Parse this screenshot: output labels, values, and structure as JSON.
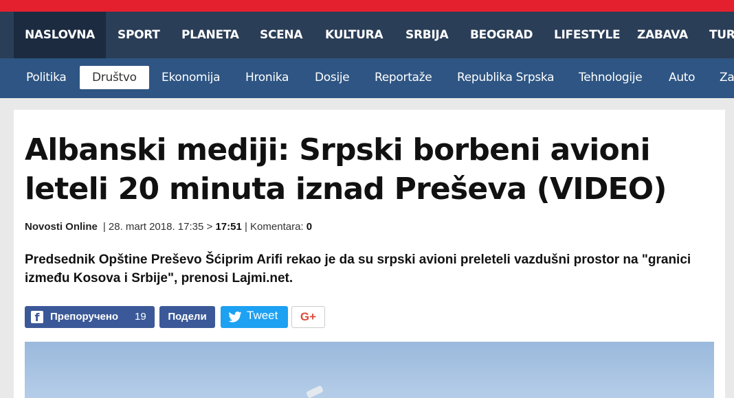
{
  "main_nav": [
    "NASLOVNA",
    "SPORT",
    "PLANETA",
    "SCENA",
    "KULTURA",
    "SRBIJA",
    "BEOGRAD",
    "LIFESTYLE",
    "ZABAVA",
    "TUR"
  ],
  "sub_nav": [
    "Politika",
    "Društvo",
    "Ekonomija",
    "Hronika",
    "Dosije",
    "Reportaže",
    "Republika Srpska",
    "Tehnologije",
    "Auto",
    "Za"
  ],
  "article": {
    "title": "Albanski mediji: Srpski borbeni avioni leteli 20 minuta iznad Preševa (VIDEO)",
    "source": "Novosti Online",
    "date_prefix": "| 28. mart 2018. 17:35 > ",
    "time": "17:51",
    "comments_label": " | Komentara: ",
    "comments": "0",
    "lead": "Predsednik Opštine Preševo Šćiprim Arifi rekao je da su srpski avioni preleteli vazdušni prostor na \"granici između Kosova i Srbije\", prenosi Lajmi.net."
  },
  "share": {
    "fb_label": "Препоручено",
    "fb_count": "19",
    "fb_share": "Подели",
    "tweet": "Tweet",
    "gplus": "G+"
  },
  "icons": {
    "facebook": "facebook-icon",
    "twitter": "twitter-bird-icon",
    "gplus": "google-plus-icon"
  },
  "colors": {
    "top_strip": "#e5202e",
    "main_nav": "#2b3e57",
    "sub_nav": "#2e5583",
    "facebook": "#3b5998",
    "twitter": "#1da1f2"
  }
}
